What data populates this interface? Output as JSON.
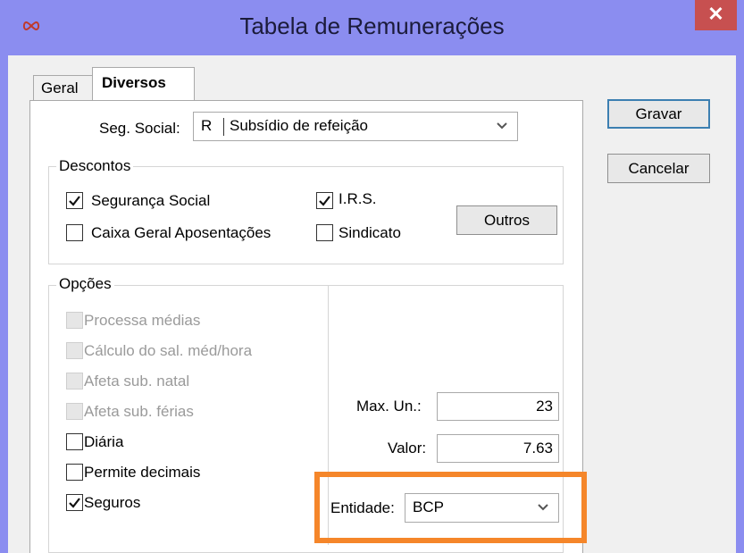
{
  "window": {
    "title": "Tabela de Remunerações",
    "close_glyph": "✕"
  },
  "tabs": [
    {
      "label": "Geral",
      "active": false
    },
    {
      "label": "Diversos",
      "active": true
    }
  ],
  "seg_social": {
    "label": "Seg. Social:",
    "code": "R",
    "value": "Subsídio de refeição"
  },
  "descontos": {
    "title": "Descontos",
    "items": [
      {
        "label": "Segurança Social",
        "checked": true
      },
      {
        "label": "I.R.S.",
        "checked": true
      },
      {
        "label": "Caixa Geral Aposentações",
        "checked": false
      },
      {
        "label": "Sindicato",
        "checked": false
      }
    ],
    "outros_button": "Outros"
  },
  "opcoes": {
    "title": "Opções",
    "items": [
      {
        "label": "Processa médias",
        "checked": false,
        "enabled": false
      },
      {
        "label": "Cálculo do sal. méd/hora",
        "checked": false,
        "enabled": false
      },
      {
        "label": "Afeta sub. natal",
        "checked": false,
        "enabled": false
      },
      {
        "label": "Afeta sub. férias",
        "checked": false,
        "enabled": false
      },
      {
        "label": "Diária",
        "checked": false,
        "enabled": true
      },
      {
        "label": "Permite decimais",
        "checked": false,
        "enabled": true
      },
      {
        "label": "Seguros",
        "checked": true,
        "enabled": true
      }
    ]
  },
  "fields": {
    "max_un_label": "Max. Un.:",
    "max_un_value": "23",
    "valor_label": "Valor:",
    "valor_value": "7.63",
    "entidade_label": "Entidade:",
    "entidade_value": "BCP"
  },
  "buttons": {
    "gravar": "Gravar",
    "cancelar": "Cancelar"
  },
  "colors": {
    "titlebar": "#8b8df0",
    "highlight": "#f5862a",
    "close": "#c75050"
  }
}
